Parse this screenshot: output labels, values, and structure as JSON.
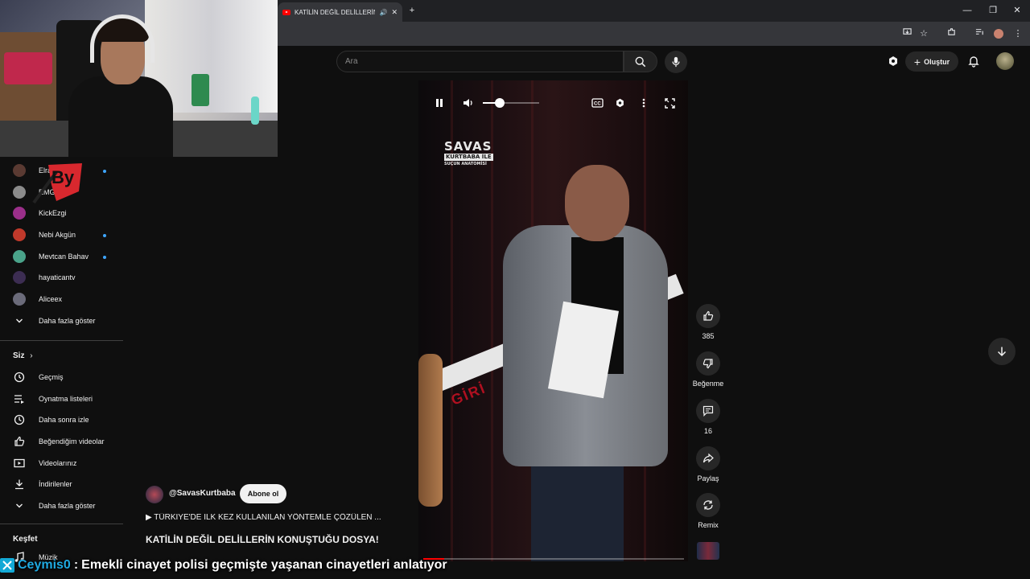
{
  "browser": {
    "tab_title": "KATİLİN DEĞİL DELİLLERİN",
    "controls": {
      "minimize": "—",
      "restore": "❐",
      "close": "✕"
    },
    "new_tab": "+"
  },
  "header": {
    "search_placeholder": "Ara",
    "create_label": "Oluştur"
  },
  "sidebar": {
    "subscriptions": [
      {
        "name": "Elra",
        "color": "#5a3a32",
        "live": true
      },
      {
        "name": "EMG",
        "color": "#8b8b8b",
        "live": false
      },
      {
        "name": "KickEzgi",
        "color": "#9b2f8a",
        "live": false
      },
      {
        "name": "Nebi Akgün",
        "color": "#c0392b",
        "live": true
      },
      {
        "name": "Mevtcan Bahav",
        "color": "#4aa38a",
        "live": true
      },
      {
        "name": "hayaticantv",
        "color": "#3c2d52",
        "live": false
      },
      {
        "name": "Aliceex",
        "color": "#6b6b7a",
        "live": false
      }
    ],
    "show_more_1": "Daha fazla göster",
    "you_heading": "Siz",
    "you_items": [
      {
        "label": "Geçmiş",
        "icon": "history-icon"
      },
      {
        "label": "Oynatma listeleri",
        "icon": "playlist-icon"
      },
      {
        "label": "Daha sonra izle",
        "icon": "clock-icon"
      },
      {
        "label": "Beğendiğim videolar",
        "icon": "thumbs-up-icon"
      },
      {
        "label": "Videolarınız",
        "icon": "video-icon"
      },
      {
        "label": "İndirilenler",
        "icon": "download-icon"
      }
    ],
    "show_more_2": "Daha fazla göster",
    "explore_heading": "Keşfet",
    "explore_items": [
      {
        "label": "Müzik",
        "icon": "music-icon"
      }
    ]
  },
  "video": {
    "logo_line1": "SAVAS",
    "logo_line2": "KURTBABA İLE",
    "logo_line3": "SUÇUN ANATOMİSİ",
    "tape_text": "GİRİ",
    "volume": 0.3,
    "progress": 0.08
  },
  "actions": {
    "like_count": "385",
    "dislike_label": "Beğenme",
    "comment_count": "16",
    "share_label": "Paylaş",
    "remix_label": "Remix"
  },
  "info": {
    "channel": "@SavasKurtbaba",
    "subscribe_label": "Abone ol",
    "description": "▶ TÜRKİYE'DE İLK KEZ KULLANILAN YÖNTEMLE ÇÖZÜLEN ...",
    "title": "KATİLİN DEĞİL DELİLLERİN KONUŞTUĞU DOSYA!"
  },
  "chat": {
    "user": "Ceymis0",
    "separator": ":",
    "message": "Emekli cinayet polisi geçmişte yaşanan cinayetleri anlatıyor"
  },
  "colors": {
    "accent": "#ff0000",
    "background": "#0f0f0f",
    "chat_user": "#1fa9e0",
    "live_dot": "#3ea6ff"
  }
}
